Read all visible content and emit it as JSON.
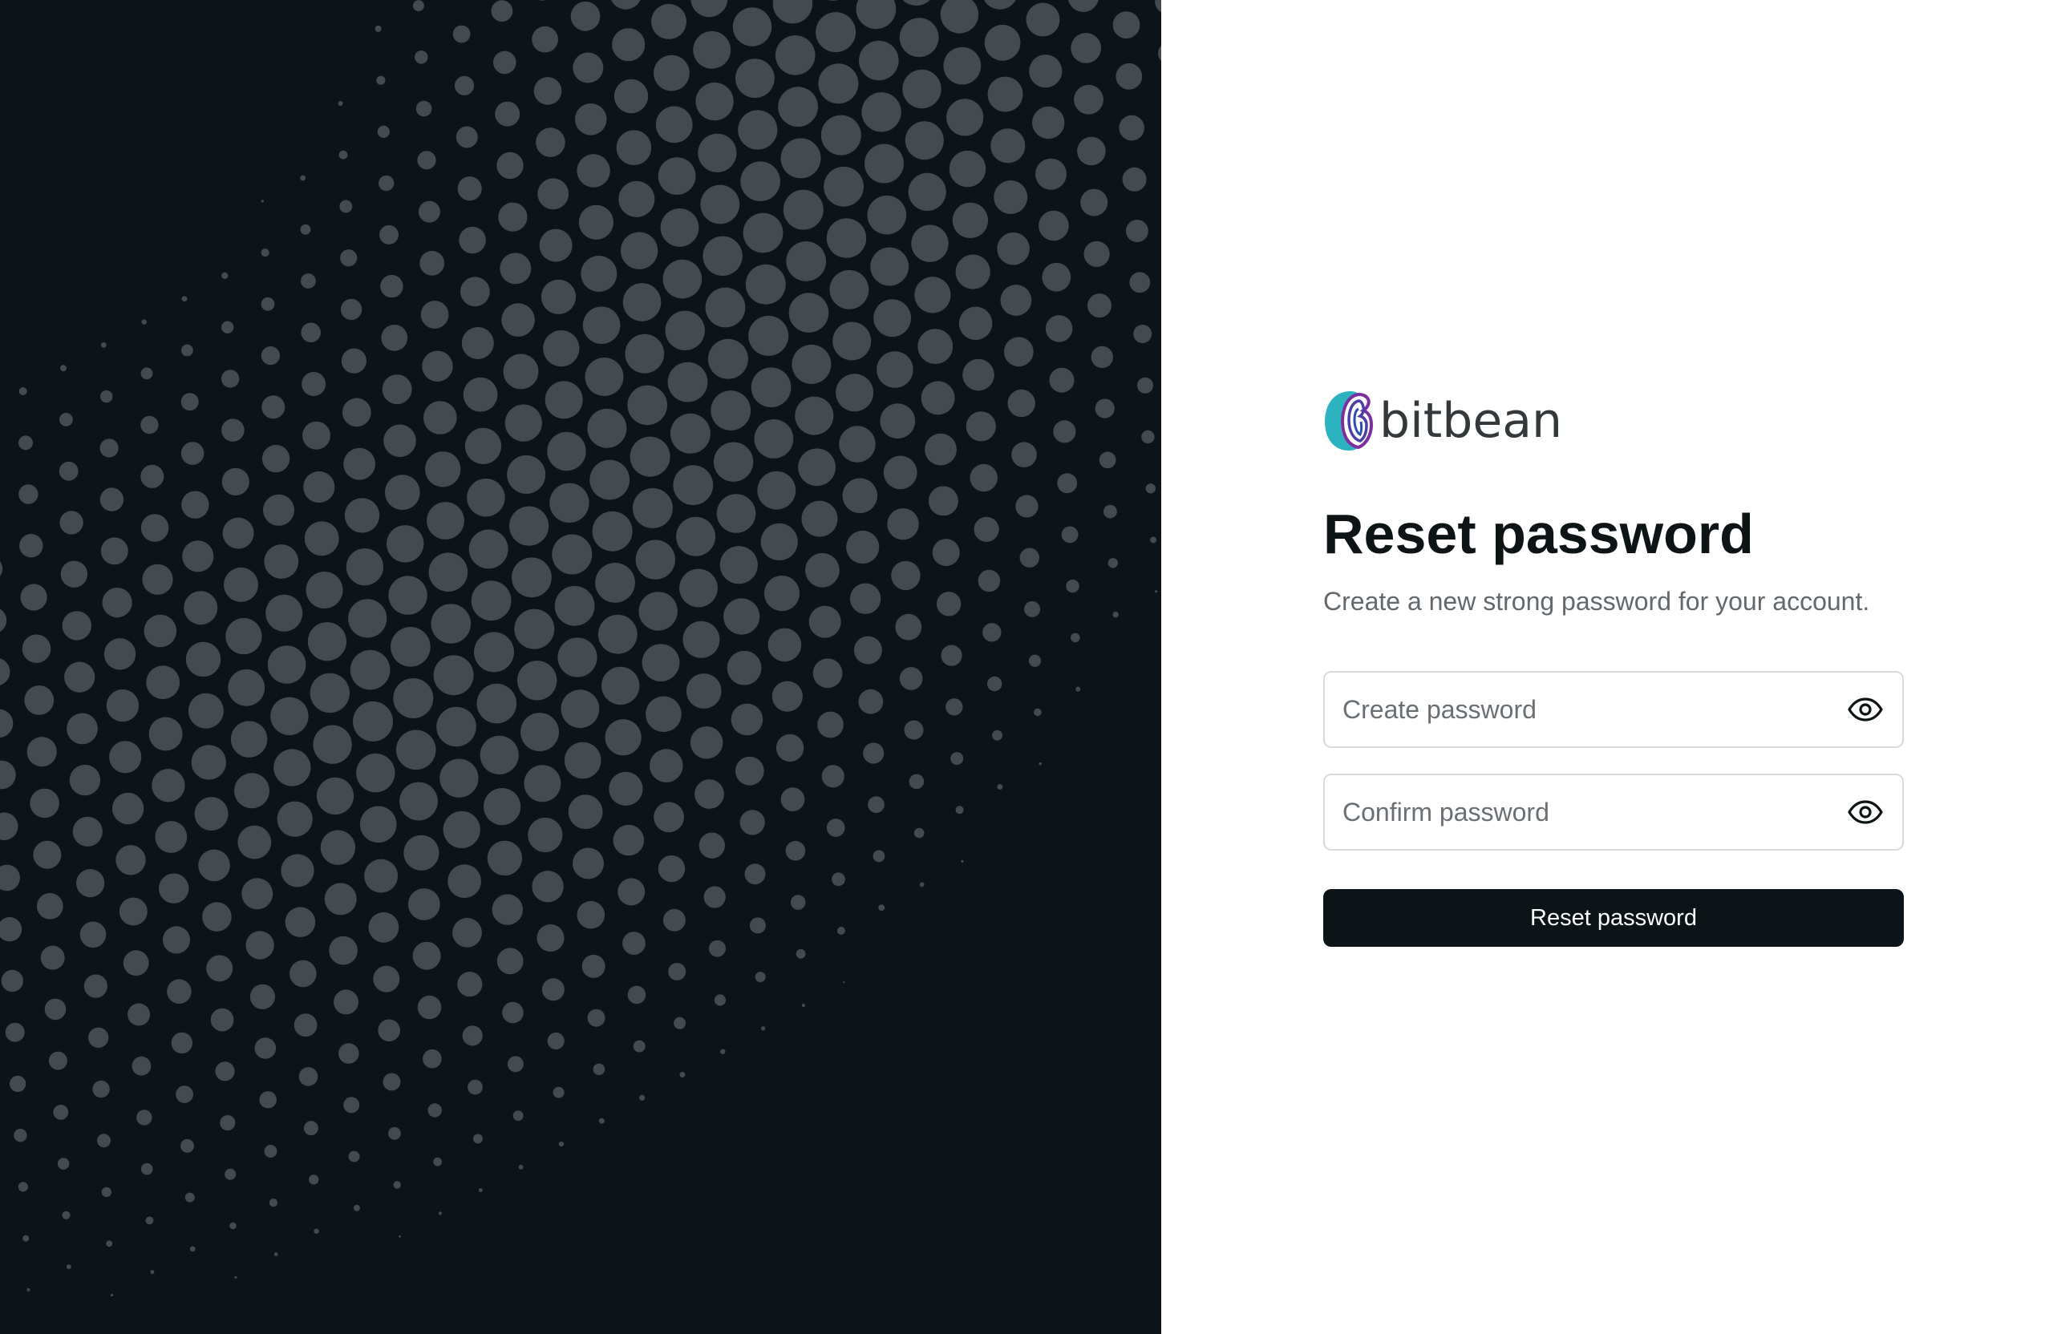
{
  "brand": {
    "name": "bitbean",
    "logo_icon": "bitbean-fingerprint-logo-icon"
  },
  "heading": {
    "title": "Reset password",
    "subtitle": "Create a new strong password for your account."
  },
  "form": {
    "create_password": {
      "placeholder": "Create password",
      "value": "",
      "toggle_icon": "eye-icon"
    },
    "confirm_password": {
      "placeholder": "Confirm password",
      "value": "",
      "toggle_icon": "eye-icon"
    },
    "submit_label": "Reset password"
  },
  "colors": {
    "dark_panel": "#0c1418",
    "dots": "#444b50",
    "button_bg": "#0c1418",
    "button_text": "#ffffff",
    "logo_teal": "#2db3c0",
    "logo_purple": "#7b2f9e"
  }
}
